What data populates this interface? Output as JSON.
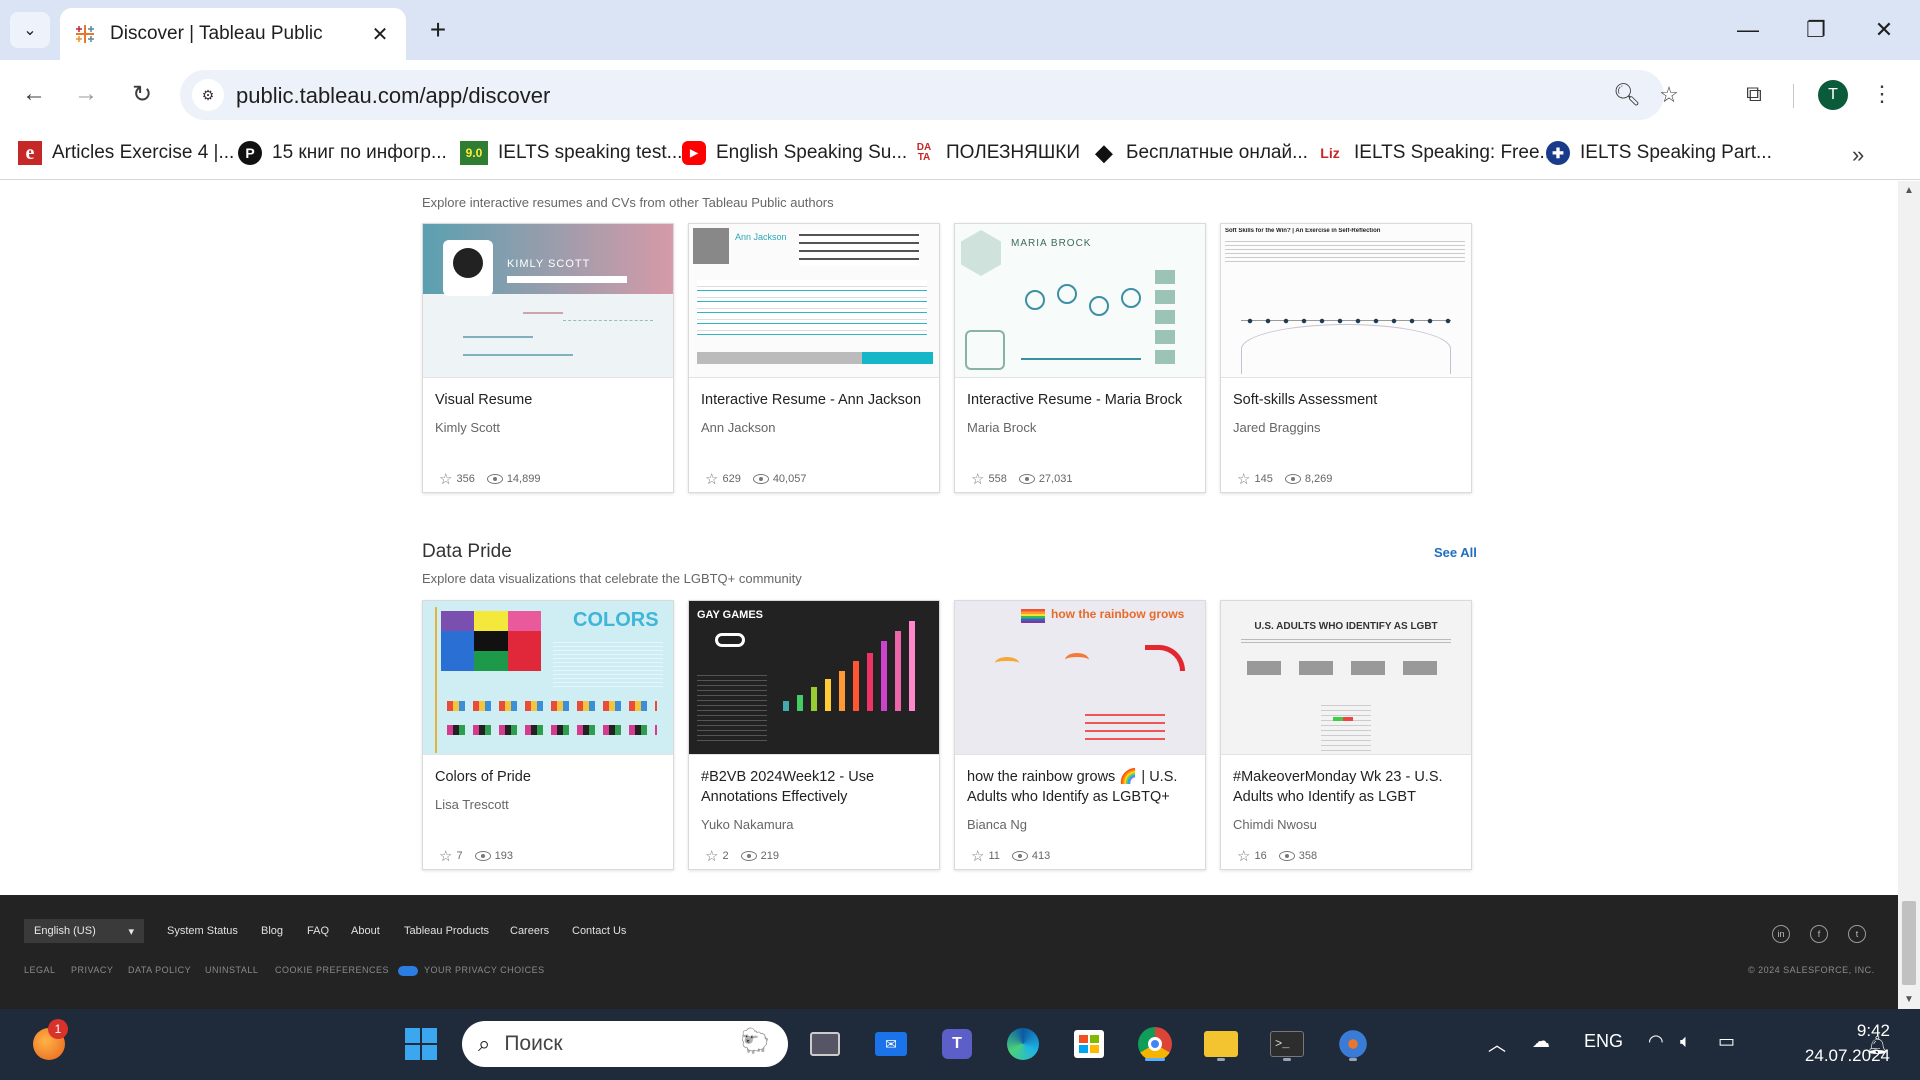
{
  "browser": {
    "tab_title": "Discover | Tableau Public",
    "url": "public.tableau.com/app/discover",
    "profile_initial": "T",
    "bookmarks": [
      {
        "label": "Articles Exercise 4 |...",
        "icon": "e"
      },
      {
        "label": "15 книг по инфогр...",
        "icon": "P"
      },
      {
        "label": "IELTS speaking test...",
        "icon": "9.0"
      },
      {
        "label": "English Speaking Su...",
        "icon": "youtube-icon"
      },
      {
        "label": "ПОЛЕЗНЯШКИ",
        "icon": "DATA"
      },
      {
        "label": "Бесплатные онлай...",
        "icon": "diamond-icon"
      },
      {
        "label": "IELTS Speaking: Free...",
        "icon": "Liz"
      },
      {
        "label": "IELTS Speaking Part...",
        "icon": "uk-flag-icon"
      }
    ]
  },
  "page": {
    "resumes_subtitle": "Explore interactive resumes and CVs from other Tableau Public authors",
    "resume_cards": [
      {
        "title": "Visual Resume",
        "author": "Kimly Scott",
        "favorites": "356",
        "views": "14,899",
        "thumb_text": "KIMLY SCOTT"
      },
      {
        "title": "Interactive Resume - Ann Jackson",
        "author": "Ann Jackson",
        "favorites": "629",
        "views": "40,057",
        "thumb_text": "Ann Jackson"
      },
      {
        "title": "Interactive Resume - Maria Brock",
        "author": "Maria Brock",
        "favorites": "558",
        "views": "27,031",
        "thumb_text": "MARIA BROCK"
      },
      {
        "title": "Soft-skills Assessment",
        "author": "Jared Braggins",
        "favorites": "145",
        "views": "8,269",
        "thumb_text": "Soft Skills for the Win? | An Exercise in Self-Reflection"
      }
    ],
    "pride_title": "Data Pride",
    "pride_subtitle": "Explore data visualizations that celebrate the LGBTQ+ community",
    "see_all": "See All",
    "pride_cards": [
      {
        "title": "Colors of Pride",
        "author": "Lisa Trescott",
        "favorites": "7",
        "views": "193",
        "thumb_text": "COLORS"
      },
      {
        "title": "#B2VB 2024Week12 - Use Annotations Effectively",
        "author": "Yuko Nakamura",
        "favorites": "2",
        "views": "219",
        "thumb_text": "GAY GAMES"
      },
      {
        "title": "how the rainbow grows 🌈 | U.S. Adults who Identify as LGBTQ+",
        "author": "Bianca Ng",
        "favorites": "11",
        "views": "413",
        "thumb_text": "how the rainbow grows"
      },
      {
        "title": "#MakeoverMonday Wk 23 - U.S. Adults who Identify as LGBT",
        "author": "Chimdi Nwosu",
        "favorites": "16",
        "views": "358",
        "thumb_text": "U.S. ADULTS WHO IDENTIFY AS LGBT"
      }
    ]
  },
  "footer": {
    "language": "English (US)",
    "links": [
      "System Status",
      "Blog",
      "FAQ",
      "About",
      "Tableau Products",
      "Careers",
      "Contact Us"
    ],
    "legal": [
      "LEGAL",
      "PRIVACY",
      "DATA POLICY",
      "UNINSTALL",
      "COOKIE PREFERENCES",
      "YOUR PRIVACY CHOICES"
    ],
    "copyright": "© 2024 SALESFORCE, INC."
  },
  "taskbar": {
    "search_placeholder": "Поиск",
    "notification_badge": "1",
    "language": "ENG",
    "time": "9:42",
    "date": "24.07.2024"
  },
  "colors": {
    "accent_link": "#1f6fbf",
    "footer_bg": "#232323",
    "taskbar_bg": "#1f2a3a"
  }
}
